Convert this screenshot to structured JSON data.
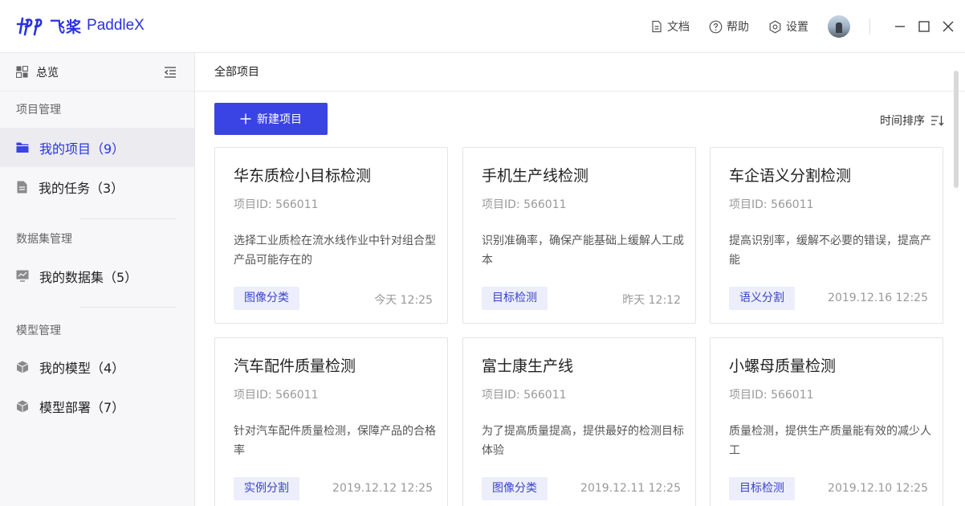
{
  "brand": {
    "name_cn": "飞桨",
    "name_en": "PaddleX",
    "color": "#2932e1"
  },
  "topbar": {
    "docs_label": "文档",
    "help_label": "帮助",
    "settings_label": "设置"
  },
  "sidebar": {
    "overview_label": "总览",
    "groups": [
      {
        "title": "项目管理",
        "items": [
          {
            "label": "我的项目（9）",
            "icon": "folder-icon",
            "active": true
          },
          {
            "label": "我的任务（3）",
            "icon": "document-icon"
          }
        ]
      },
      {
        "title": "数据集管理",
        "items": [
          {
            "label": "我的数据集（5）",
            "icon": "monitor-chart-icon"
          }
        ]
      },
      {
        "title": "模型管理",
        "items": [
          {
            "label": "我的模型（4）",
            "icon": "cube-icon"
          },
          {
            "label": "模型部署（7）",
            "icon": "cube-icon"
          }
        ]
      }
    ]
  },
  "main": {
    "breadcrumb": "全部项目",
    "new_button_label": "新建项目",
    "sort_label": "时间排序",
    "cards": [
      {
        "title": "华东质检小目标检测",
        "project_id": "项目ID: 566011",
        "description": "选择工业质检在流水线作业中针对组合型产品可能存在的",
        "tag": "图像分类",
        "time": "今天  12:25"
      },
      {
        "title": "手机生产线检测",
        "project_id": "项目ID: 566011",
        "description": "识别准确率，确保产能基础上缓解人工成本",
        "tag": "目标检测",
        "time": "昨天  12:12"
      },
      {
        "title": "车企语义分割检测",
        "project_id": "项目ID: 566011",
        "description": "提高识别率，缓解不必要的错误，提高产能",
        "tag": "语义分割",
        "time": "2019.12.16  12:25"
      },
      {
        "title": "汽车配件质量检测",
        "project_id": "项目ID: 566011",
        "description": "针对汽车配件质量检测，保障产品的合格率",
        "tag": "实例分割",
        "time": "2019.12.12  12:25"
      },
      {
        "title": "富士康生产线",
        "project_id": "项目ID: 566011",
        "description": "为了提高质量提高，提供最好的检测目标体验",
        "tag": "图像分类",
        "time": "2019.12.11  12:25"
      },
      {
        "title": "小螺母质量检测",
        "project_id": "项目ID: 566011",
        "description": "质量检测，提供生产质量能有效的减少人工",
        "tag": "目标检测",
        "time": "2019.12.10  12:25"
      }
    ]
  }
}
